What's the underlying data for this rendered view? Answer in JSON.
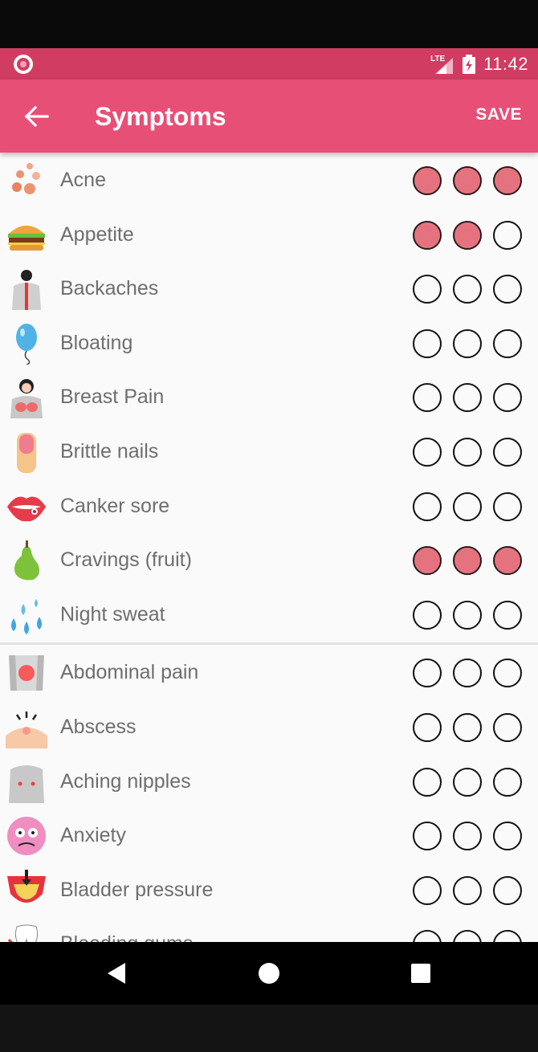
{
  "status_bar": {
    "network": "LTE",
    "time": "11:42"
  },
  "app_bar": {
    "title": "Symptoms",
    "save_label": "SAVE",
    "back_icon": "arrow-left-icon"
  },
  "colors": {
    "app_bar": "#e84f76",
    "status_bar": "#d03c62",
    "selected_circle": "#e5737f"
  },
  "symptoms_group_1": [
    {
      "label": "Acne",
      "icon": "acne-icon",
      "level": 3
    },
    {
      "label": "Appetite",
      "icon": "burger-icon",
      "level": 2
    },
    {
      "label": "Backaches",
      "icon": "back-icon",
      "level": 0
    },
    {
      "label": "Bloating",
      "icon": "balloon-icon",
      "level": 0
    },
    {
      "label": "Breast Pain",
      "icon": "breast-icon",
      "level": 0
    },
    {
      "label": "Brittle nails",
      "icon": "nail-icon",
      "level": 0
    },
    {
      "label": "Canker sore",
      "icon": "lips-icon",
      "level": 0
    },
    {
      "label": "Cravings (fruit)",
      "icon": "pear-icon",
      "level": 3
    },
    {
      "label": "Night sweat",
      "icon": "droplets-icon",
      "level": 0
    }
  ],
  "symptoms_group_2": [
    {
      "label": "Abdominal pain",
      "icon": "abdomen-icon",
      "level": 0
    },
    {
      "label": "Abscess",
      "icon": "abscess-icon",
      "level": 0
    },
    {
      "label": "Aching nipples",
      "icon": "chest-icon",
      "level": 0
    },
    {
      "label": "Anxiety",
      "icon": "anxious-face-icon",
      "level": 0
    },
    {
      "label": "Bladder pressure",
      "icon": "bladder-icon",
      "level": 0
    },
    {
      "label": "Bleeding gums",
      "icon": "tooth-icon",
      "level": 0
    }
  ],
  "nav_bar": {
    "back": "triangle-back-icon",
    "home": "circle-home-icon",
    "recents": "square-recents-icon"
  }
}
